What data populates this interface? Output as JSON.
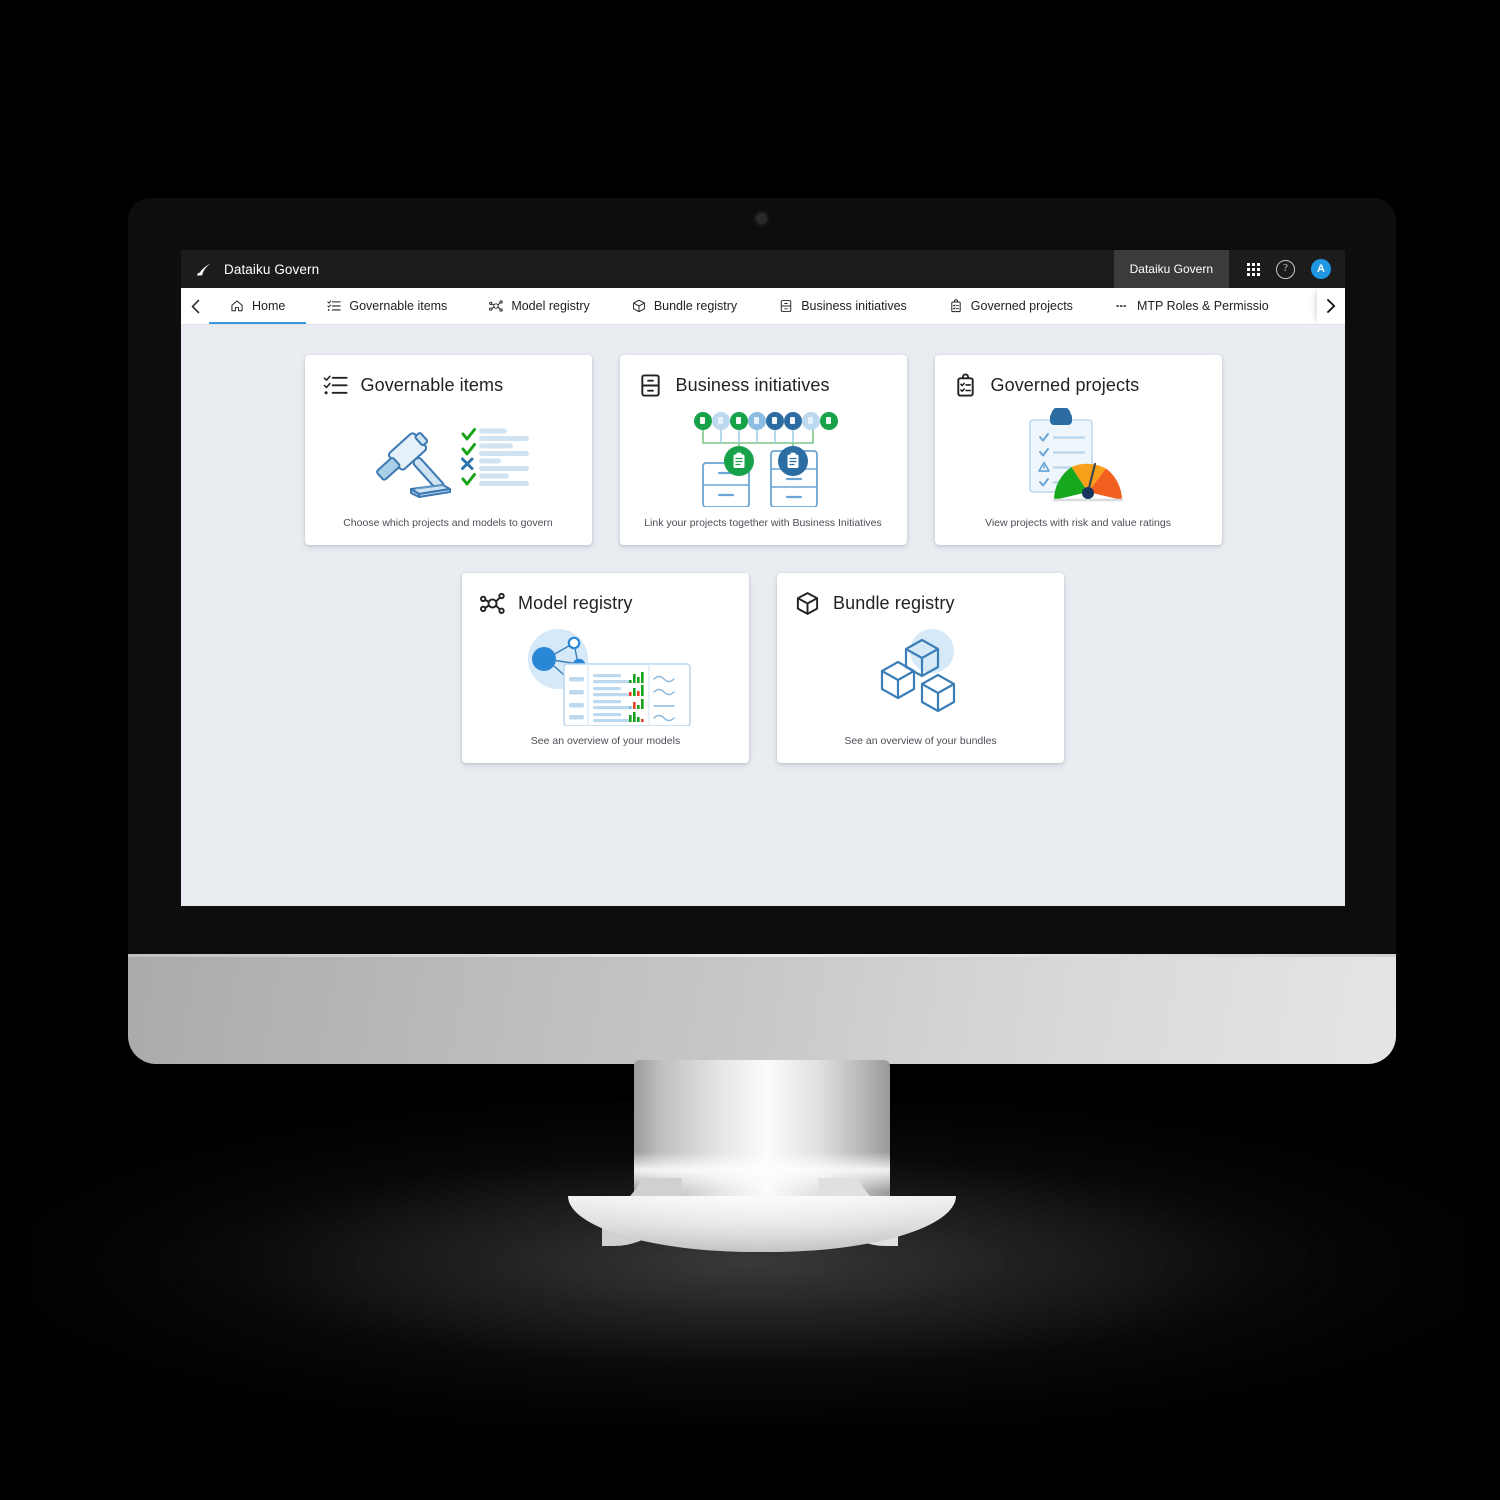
{
  "app": {
    "brand_name": "Dataiku Govern",
    "brand_logo_icon": "dataiku-logo-icon",
    "product_chip": "Dataiku Govern",
    "apps_grid_icon": "apps-grid-icon",
    "help_icon": "help-circle-icon",
    "help_glyph": "?",
    "avatar_initial": "A",
    "avatar_color": "#2196e3"
  },
  "tabbar": {
    "scroll_left_icon": "chevron-left-icon",
    "scroll_right_icon": "chevron-right-icon",
    "active_tab": "Home",
    "accent_color": "#3b99e0",
    "tabs": [
      {
        "label": "Home",
        "icon": "home-icon",
        "active": true
      },
      {
        "label": "Governable items",
        "icon": "checklist-icon",
        "active": false
      },
      {
        "label": "Model registry",
        "icon": "model-nodes-icon",
        "active": false
      },
      {
        "label": "Bundle registry",
        "icon": "cube-icon",
        "active": false
      },
      {
        "label": "Business initiatives",
        "icon": "cabinet-icon",
        "active": false
      },
      {
        "label": "Governed projects",
        "icon": "clipboard-lock-icon",
        "active": false
      },
      {
        "label": "MTP Roles & Permissio",
        "icon": "dashes-icon",
        "active": false
      }
    ]
  },
  "content": {
    "background_color": "#e9edf2",
    "rows": [
      [
        {
          "title": "Governable items",
          "head_icon": "checklist-icon",
          "art_icon": "gavel-checklist-art",
          "description": "Choose which projects and models to govern"
        },
        {
          "title": "Business initiatives",
          "head_icon": "cabinet-icon",
          "art_icon": "initiatives-timeline-art",
          "description": "Link your projects together with Business Initiatives"
        },
        {
          "title": "Governed projects",
          "head_icon": "clipboard-lock-icon",
          "art_icon": "clipboard-gauge-art",
          "description": "View projects with risk and value ratings"
        }
      ],
      [
        {
          "title": "Model registry",
          "head_icon": "model-nodes-icon",
          "art_icon": "model-table-art",
          "description": "See an overview of your models"
        },
        {
          "title": "Bundle registry",
          "head_icon": "cube-icon",
          "art_icon": "cubes-art",
          "description": "See an overview of your bundles"
        }
      ]
    ]
  },
  "device": {
    "type": "desktop-monitor",
    "bezel_color": "#0d0d0d",
    "chin_color": "#c6c7c9",
    "camera_icon": "camera-dot-icon"
  }
}
